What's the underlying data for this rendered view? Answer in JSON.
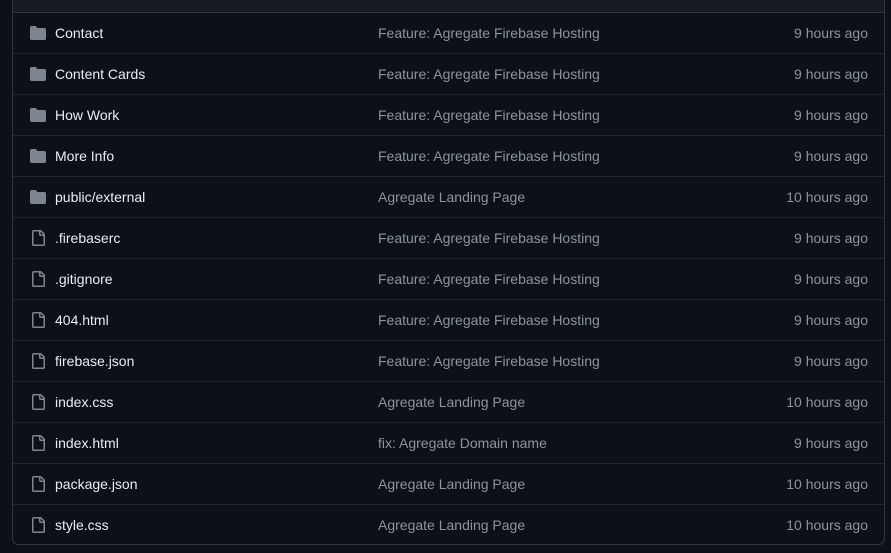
{
  "colors": {
    "background": "#0d1117",
    "border": "#30363d",
    "row_divider": "#21262d",
    "primary_text": "#e6edf3",
    "muted_text": "#8b949e",
    "folder_icon": "#7d8590"
  },
  "files": [
    {
      "type": "folder",
      "icon": "folder-icon",
      "name": "Contact",
      "commit": "Feature: Agregate Firebase Hosting",
      "age": "9 hours ago"
    },
    {
      "type": "folder",
      "icon": "folder-icon",
      "name": "Content Cards",
      "commit": "Feature: Agregate Firebase Hosting",
      "age": "9 hours ago"
    },
    {
      "type": "folder",
      "icon": "folder-icon",
      "name": "How Work",
      "commit": "Feature: Agregate Firebase Hosting",
      "age": "9 hours ago"
    },
    {
      "type": "folder",
      "icon": "folder-icon",
      "name": "More Info",
      "commit": "Feature: Agregate Firebase Hosting",
      "age": "9 hours ago"
    },
    {
      "type": "folder",
      "icon": "folder-icon",
      "name": "public/external",
      "commit": "Agregate Landing Page",
      "age": "10 hours ago"
    },
    {
      "type": "file",
      "icon": "file-icon",
      "name": ".firebaserc",
      "commit": "Feature: Agregate Firebase Hosting",
      "age": "9 hours ago"
    },
    {
      "type": "file",
      "icon": "file-icon",
      "name": ".gitignore",
      "commit": "Feature: Agregate Firebase Hosting",
      "age": "9 hours ago"
    },
    {
      "type": "file",
      "icon": "file-icon",
      "name": "404.html",
      "commit": "Feature: Agregate Firebase Hosting",
      "age": "9 hours ago"
    },
    {
      "type": "file",
      "icon": "file-icon",
      "name": "firebase.json",
      "commit": "Feature: Agregate Firebase Hosting",
      "age": "9 hours ago"
    },
    {
      "type": "file",
      "icon": "file-icon",
      "name": "index.css",
      "commit": "Agregate Landing Page",
      "age": "10 hours ago"
    },
    {
      "type": "file",
      "icon": "file-icon",
      "name": "index.html",
      "commit": "fix: Agregate Domain name",
      "age": "9 hours ago"
    },
    {
      "type": "file",
      "icon": "file-icon",
      "name": "package.json",
      "commit": "Agregate Landing Page",
      "age": "10 hours ago"
    },
    {
      "type": "file",
      "icon": "file-icon",
      "name": "style.css",
      "commit": "Agregate Landing Page",
      "age": "10 hours ago"
    }
  ]
}
